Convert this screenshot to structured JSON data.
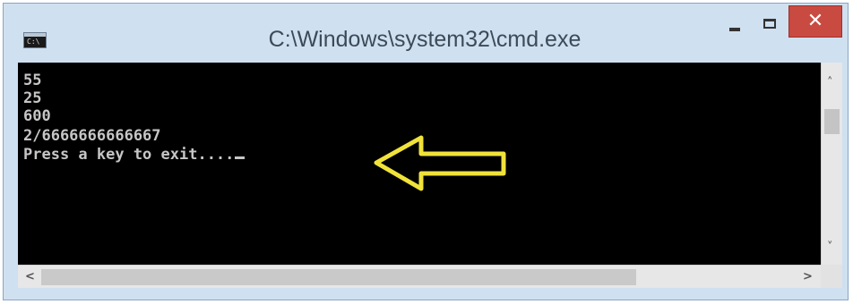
{
  "window": {
    "title": "C:\\Windows\\system32\\cmd.exe",
    "app_icon_text": "C:\\",
    "controls": {
      "minimize_icon": "minimize-icon",
      "maximize_icon": "maximize-icon",
      "close_label": "✕"
    }
  },
  "console": {
    "lines": [
      "55",
      "25",
      "600",
      "2/6666666666667",
      "Press a key to exit...."
    ],
    "annotation": {
      "icon": "arrow-left-icon",
      "color": "#f1e23a"
    }
  },
  "scrollbars": {
    "vertical": {
      "up": "˄",
      "down": "˅"
    },
    "horizontal": {
      "left": "<",
      "right": ">"
    }
  },
  "colors": {
    "titlebar": "#cfe0f0",
    "console_bg": "#000000",
    "console_text": "#c6c6c6",
    "close_button": "#c94a41"
  }
}
